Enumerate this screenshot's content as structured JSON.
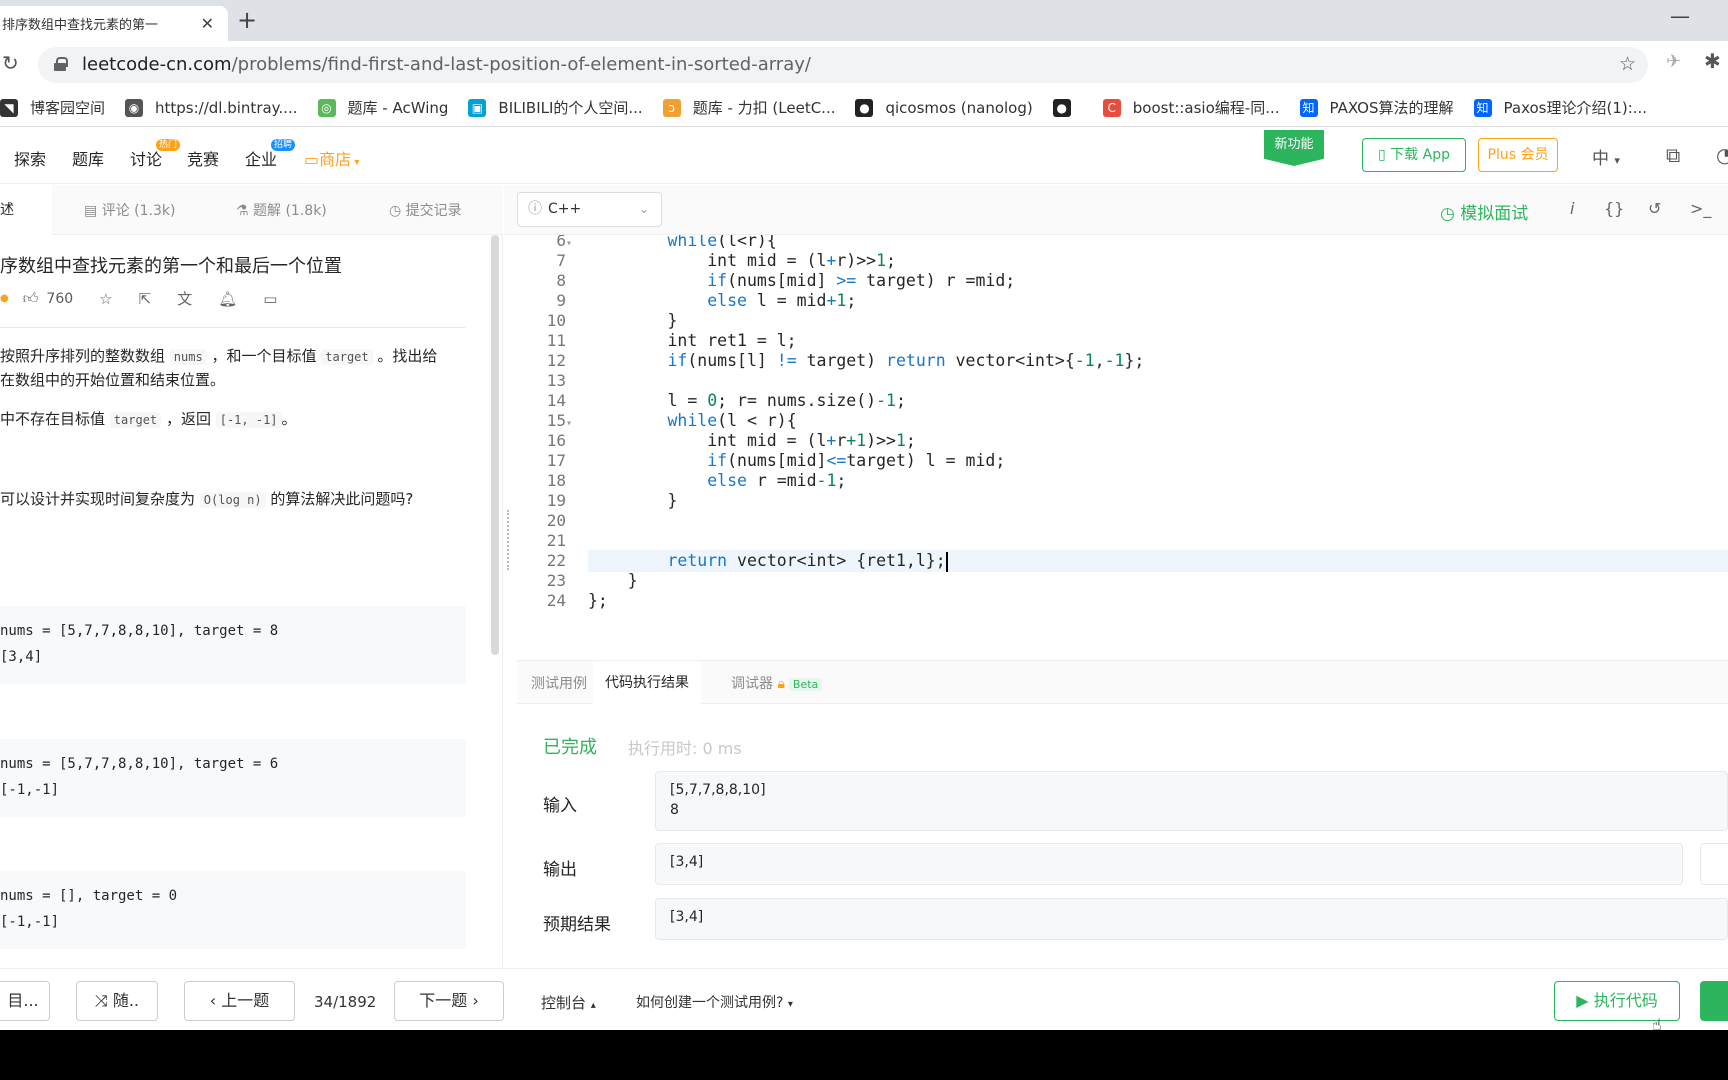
{
  "browser": {
    "tab_title": "排序数组中查找元素的第一",
    "url_host": "leetcode-cn.com",
    "url_path": "/problems/find-first-and-last-position-of-element-in-sorted-array/",
    "bookmarks": [
      {
        "label": "博客园空间",
        "icon": "blog-icon",
        "color": "#333"
      },
      {
        "label": "https://dl.bintray....",
        "icon": "globe-icon",
        "color": "#555"
      },
      {
        "label": "题库 - AcWing",
        "icon": "acwing-icon",
        "color": "#5cb85c"
      },
      {
        "label": "BILIBILI的个人空间...",
        "icon": "bilibili-icon",
        "color": "#00a1d6"
      },
      {
        "label": "题库 - 力扣 (LeetC...",
        "icon": "leetcode-icon",
        "color": "#f0a030"
      },
      {
        "label": "qicosmos (nanolog)",
        "icon": "github-icon",
        "color": "#222"
      },
      {
        "label": "",
        "icon": "github-icon",
        "color": "#222"
      },
      {
        "label": "boost::asio编程-同...",
        "icon": "csdn-icon",
        "color": "#e74c3c"
      },
      {
        "label": "PAXOS算法的理解",
        "icon": "zhihu-icon",
        "color": "#0066ff"
      },
      {
        "label": "Paxos理论介绍(1):...",
        "icon": "zhihu-icon",
        "color": "#0066ff"
      }
    ]
  },
  "nav": {
    "items": [
      "探索",
      "题库",
      "讨论",
      "竞赛",
      "企业"
    ],
    "hot_badge": "热门",
    "hire_badge": "招聘",
    "shop": "商店",
    "new_feature": "新功能",
    "download_app": "下载 App",
    "plus": "Plus 会员",
    "lang": "中"
  },
  "left_tabs": {
    "desc": "描述",
    "comments": "评论 (1.3k)",
    "solutions": "题解 (1.8k)",
    "submissions": "提交记录"
  },
  "problem": {
    "title": "序数组中查找元素的第一个和最后一个位置",
    "likes": "760",
    "desc1a": "按照升序排列的整数数组",
    "desc1_code1": "nums",
    "desc1b": "，和一个目标值",
    "desc1_code2": "target",
    "desc1c": "。找出给",
    "desc2": "在数组中的开始位置和结束位置。",
    "desc3a": "中不存在目标值",
    "desc3_code1": "target",
    "desc3b": "，返回",
    "desc3_code2": "[-1, -1]",
    "desc3c": "。",
    "desc4a": "可以设计并实现时间复杂度为",
    "desc4_code": "O(log n)",
    "desc4b": "的算法解决此问题吗?",
    "examples": [
      {
        "input": "nums = [5,7,7,8,8,10], target = 8",
        "output": "[3,4]"
      },
      {
        "input": "nums = [5,7,7,8,8,10], target = 6",
        "output": "[-1,-1]"
      },
      {
        "input": "nums = [], target = 0",
        "output": "[-1,-1]"
      }
    ]
  },
  "editor": {
    "language": "C++",
    "mock_interview": "模拟面试",
    "lines": [
      {
        "n": "6",
        "fold": "▾",
        "segs": [
          [
            "        ",
            ""
          ],
          [
            "while",
            "kw"
          ],
          [
            "(l<r){",
            ""
          ]
        ]
      },
      {
        "n": "7",
        "fold": "",
        "segs": [
          [
            "            int mid = (l",
            ""
          ],
          [
            "+",
            "op"
          ],
          [
            "r)>>",
            ""
          ],
          [
            "1",
            "num"
          ],
          [
            ";",
            ""
          ]
        ]
      },
      {
        "n": "8",
        "fold": "",
        "segs": [
          [
            "            ",
            ""
          ],
          [
            "if",
            "kw"
          ],
          [
            "(nums[mid] ",
            ""
          ],
          [
            ">=",
            "op"
          ],
          [
            " target) r =mid;",
            ""
          ]
        ]
      },
      {
        "n": "9",
        "fold": "",
        "segs": [
          [
            "            ",
            ""
          ],
          [
            "else",
            "kw"
          ],
          [
            " l = mid",
            ""
          ],
          [
            "+",
            "op"
          ],
          [
            "1",
            "num"
          ],
          [
            ";",
            ""
          ]
        ]
      },
      {
        "n": "10",
        "fold": "",
        "segs": [
          [
            "        }",
            ""
          ]
        ]
      },
      {
        "n": "11",
        "fold": "",
        "segs": [
          [
            "        int ret1 = l;",
            ""
          ]
        ]
      },
      {
        "n": "12",
        "fold": "",
        "segs": [
          [
            "        ",
            ""
          ],
          [
            "if",
            "kw"
          ],
          [
            "(nums[l] ",
            ""
          ],
          [
            "!=",
            "op"
          ],
          [
            " target) ",
            ""
          ],
          [
            "return",
            "kw"
          ],
          [
            " vector<int>{",
            ""
          ],
          [
            "-1",
            "num"
          ],
          [
            ",",
            ""
          ],
          [
            "-1",
            "num"
          ],
          [
            "};",
            ""
          ]
        ]
      },
      {
        "n": "13",
        "fold": "",
        "segs": [
          [
            "",
            ""
          ]
        ]
      },
      {
        "n": "14",
        "fold": "",
        "segs": [
          [
            "        l = ",
            ""
          ],
          [
            "0",
            "num"
          ],
          [
            "; r= nums.size()",
            ""
          ],
          [
            "-1",
            "num"
          ],
          [
            ";",
            ""
          ]
        ]
      },
      {
        "n": "15",
        "fold": "▾",
        "segs": [
          [
            "        ",
            ""
          ],
          [
            "while",
            "kw"
          ],
          [
            "(l < r){",
            ""
          ]
        ]
      },
      {
        "n": "16",
        "fold": "",
        "segs": [
          [
            "            int mid = (l",
            ""
          ],
          [
            "+",
            "op"
          ],
          [
            "r",
            ""
          ],
          [
            "+1",
            "num"
          ],
          [
            ")>>",
            ""
          ],
          [
            "1",
            "num"
          ],
          [
            ";",
            ""
          ]
        ]
      },
      {
        "n": "17",
        "fold": "",
        "segs": [
          [
            "            ",
            ""
          ],
          [
            "if",
            "kw"
          ],
          [
            "(nums[mid]",
            ""
          ],
          [
            "<=",
            "op"
          ],
          [
            "target) l = mid;",
            ""
          ]
        ]
      },
      {
        "n": "18",
        "fold": "",
        "segs": [
          [
            "            ",
            ""
          ],
          [
            "else",
            "kw"
          ],
          [
            " r =mid",
            ""
          ],
          [
            "-1",
            "num"
          ],
          [
            ";",
            ""
          ]
        ]
      },
      {
        "n": "19",
        "fold": "",
        "segs": [
          [
            "        }",
            ""
          ]
        ]
      },
      {
        "n": "20",
        "fold": "",
        "segs": [
          [
            "",
            ""
          ]
        ]
      },
      {
        "n": "21",
        "fold": "",
        "segs": [
          [
            "",
            ""
          ]
        ]
      },
      {
        "n": "22",
        "fold": "",
        "segs": [
          [
            "        ",
            ""
          ],
          [
            "return",
            "kw"
          ],
          [
            " vector<int> {ret1,l};",
            ""
          ]
        ],
        "active": true
      },
      {
        "n": "23",
        "fold": "",
        "segs": [
          [
            "    }",
            ""
          ]
        ]
      },
      {
        "n": "24",
        "fold": "",
        "segs": [
          [
            "};",
            ""
          ]
        ]
      }
    ]
  },
  "result": {
    "tab_testcase": "测试用例",
    "tab_result": "代码执行结果",
    "tab_debugger": "调试器",
    "beta": "Beta",
    "status": "已完成",
    "runtime": "执行用时: 0 ms",
    "input_label": "输入",
    "input_value": "[5,7,7,8,8,10]\n8",
    "output_label": "输出",
    "output_value": "[3,4]",
    "expected_label": "预期结果",
    "expected_value": "[3,4]"
  },
  "footer": {
    "list_btn": "目...",
    "random_btn": "随..",
    "prev_btn": "上一题",
    "page": "34/1892",
    "next_btn": "下一题",
    "console": "控制台",
    "how_to": "如何创建一个测试用例?",
    "run": "执行代码"
  }
}
